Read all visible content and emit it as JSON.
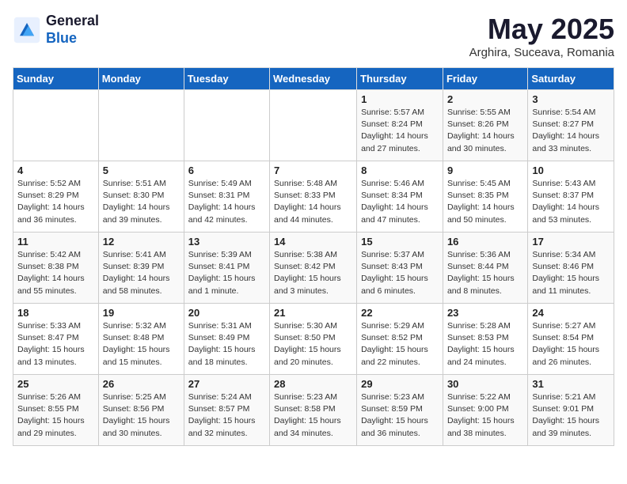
{
  "logo": {
    "line1": "General",
    "line2": "Blue"
  },
  "title": "May 2025",
  "subtitle": "Arghira, Suceava, Romania",
  "weekdays": [
    "Sunday",
    "Monday",
    "Tuesday",
    "Wednesday",
    "Thursday",
    "Friday",
    "Saturday"
  ],
  "weeks": [
    [
      {
        "day": "",
        "info": ""
      },
      {
        "day": "",
        "info": ""
      },
      {
        "day": "",
        "info": ""
      },
      {
        "day": "",
        "info": ""
      },
      {
        "day": "1",
        "info": "Sunrise: 5:57 AM\nSunset: 8:24 PM\nDaylight: 14 hours\nand 27 minutes."
      },
      {
        "day": "2",
        "info": "Sunrise: 5:55 AM\nSunset: 8:26 PM\nDaylight: 14 hours\nand 30 minutes."
      },
      {
        "day": "3",
        "info": "Sunrise: 5:54 AM\nSunset: 8:27 PM\nDaylight: 14 hours\nand 33 minutes."
      }
    ],
    [
      {
        "day": "4",
        "info": "Sunrise: 5:52 AM\nSunset: 8:29 PM\nDaylight: 14 hours\nand 36 minutes."
      },
      {
        "day": "5",
        "info": "Sunrise: 5:51 AM\nSunset: 8:30 PM\nDaylight: 14 hours\nand 39 minutes."
      },
      {
        "day": "6",
        "info": "Sunrise: 5:49 AM\nSunset: 8:31 PM\nDaylight: 14 hours\nand 42 minutes."
      },
      {
        "day": "7",
        "info": "Sunrise: 5:48 AM\nSunset: 8:33 PM\nDaylight: 14 hours\nand 44 minutes."
      },
      {
        "day": "8",
        "info": "Sunrise: 5:46 AM\nSunset: 8:34 PM\nDaylight: 14 hours\nand 47 minutes."
      },
      {
        "day": "9",
        "info": "Sunrise: 5:45 AM\nSunset: 8:35 PM\nDaylight: 14 hours\nand 50 minutes."
      },
      {
        "day": "10",
        "info": "Sunrise: 5:43 AM\nSunset: 8:37 PM\nDaylight: 14 hours\nand 53 minutes."
      }
    ],
    [
      {
        "day": "11",
        "info": "Sunrise: 5:42 AM\nSunset: 8:38 PM\nDaylight: 14 hours\nand 55 minutes."
      },
      {
        "day": "12",
        "info": "Sunrise: 5:41 AM\nSunset: 8:39 PM\nDaylight: 14 hours\nand 58 minutes."
      },
      {
        "day": "13",
        "info": "Sunrise: 5:39 AM\nSunset: 8:41 PM\nDaylight: 15 hours\nand 1 minute."
      },
      {
        "day": "14",
        "info": "Sunrise: 5:38 AM\nSunset: 8:42 PM\nDaylight: 15 hours\nand 3 minutes."
      },
      {
        "day": "15",
        "info": "Sunrise: 5:37 AM\nSunset: 8:43 PM\nDaylight: 15 hours\nand 6 minutes."
      },
      {
        "day": "16",
        "info": "Sunrise: 5:36 AM\nSunset: 8:44 PM\nDaylight: 15 hours\nand 8 minutes."
      },
      {
        "day": "17",
        "info": "Sunrise: 5:34 AM\nSunset: 8:46 PM\nDaylight: 15 hours\nand 11 minutes."
      }
    ],
    [
      {
        "day": "18",
        "info": "Sunrise: 5:33 AM\nSunset: 8:47 PM\nDaylight: 15 hours\nand 13 minutes."
      },
      {
        "day": "19",
        "info": "Sunrise: 5:32 AM\nSunset: 8:48 PM\nDaylight: 15 hours\nand 15 minutes."
      },
      {
        "day": "20",
        "info": "Sunrise: 5:31 AM\nSunset: 8:49 PM\nDaylight: 15 hours\nand 18 minutes."
      },
      {
        "day": "21",
        "info": "Sunrise: 5:30 AM\nSunset: 8:50 PM\nDaylight: 15 hours\nand 20 minutes."
      },
      {
        "day": "22",
        "info": "Sunrise: 5:29 AM\nSunset: 8:52 PM\nDaylight: 15 hours\nand 22 minutes."
      },
      {
        "day": "23",
        "info": "Sunrise: 5:28 AM\nSunset: 8:53 PM\nDaylight: 15 hours\nand 24 minutes."
      },
      {
        "day": "24",
        "info": "Sunrise: 5:27 AM\nSunset: 8:54 PM\nDaylight: 15 hours\nand 26 minutes."
      }
    ],
    [
      {
        "day": "25",
        "info": "Sunrise: 5:26 AM\nSunset: 8:55 PM\nDaylight: 15 hours\nand 29 minutes."
      },
      {
        "day": "26",
        "info": "Sunrise: 5:25 AM\nSunset: 8:56 PM\nDaylight: 15 hours\nand 30 minutes."
      },
      {
        "day": "27",
        "info": "Sunrise: 5:24 AM\nSunset: 8:57 PM\nDaylight: 15 hours\nand 32 minutes."
      },
      {
        "day": "28",
        "info": "Sunrise: 5:23 AM\nSunset: 8:58 PM\nDaylight: 15 hours\nand 34 minutes."
      },
      {
        "day": "29",
        "info": "Sunrise: 5:23 AM\nSunset: 8:59 PM\nDaylight: 15 hours\nand 36 minutes."
      },
      {
        "day": "30",
        "info": "Sunrise: 5:22 AM\nSunset: 9:00 PM\nDaylight: 15 hours\nand 38 minutes."
      },
      {
        "day": "31",
        "info": "Sunrise: 5:21 AM\nSunset: 9:01 PM\nDaylight: 15 hours\nand 39 minutes."
      }
    ]
  ]
}
